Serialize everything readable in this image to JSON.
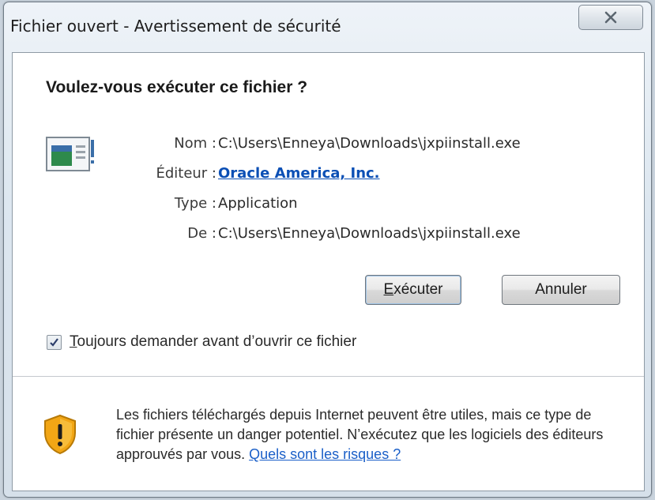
{
  "window": {
    "title": "Fichier ouvert - Avertissement de sécurité",
    "close_glyph": "✕"
  },
  "dialog": {
    "heading": "Voulez-vous exécuter ce fichier ?",
    "fields": [
      {
        "label": "Nom :",
        "value": "C:\\Users\\Enneya\\Downloads\\jxpiinstall.exe"
      },
      {
        "label": "Éditeur :",
        "value": "Oracle America, Inc."
      },
      {
        "label": "Type :",
        "value": "Application"
      },
      {
        "label": "De :",
        "value": "C:\\Users\\Enneya\\Downloads\\jxpiinstall.exe"
      }
    ],
    "buttons": {
      "run_first": "E",
      "run_rest": "xécuter",
      "cancel": "Annuler"
    },
    "checkbox": {
      "checked": true,
      "label_first": "T",
      "label_rest": "oujours demander avant d’ouvrir ce fichier"
    }
  },
  "footer": {
    "text": "Les fichiers téléchargés depuis Internet peuvent être utiles, mais ce type de fichier présente un danger potentiel. N’exécutez que les logiciels des éditeurs approuvés par vous. ",
    "link": "Quels sont les risques ?"
  },
  "icons": {
    "file": "application-file-icon",
    "shield": "security-shield-icon",
    "close": "close-icon",
    "check": "checkmark-icon"
  },
  "colors": {
    "link": "#0b4fb5",
    "shield": "#f2a615"
  }
}
